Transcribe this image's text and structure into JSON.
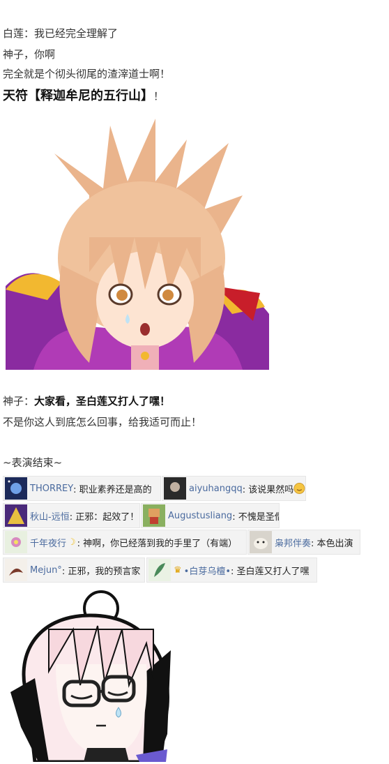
{
  "text": {
    "l1": "白莲：我已经完全理解了",
    "l2": "神子，你啊",
    "l3": "完全就是个彻头彻尾的渣滓道士啊！",
    "l4_bold": "天符【释迦牟尼的五行山】",
    "l4_tail": "！",
    "l5_prefix": "神子：",
    "l5_bold": "大家看，圣白莲又打人了嘿！",
    "l6": "不是你这人到底怎么回事，给我适可而止！",
    "l7": "~表演结束~"
  },
  "comments": [
    {
      "user": "THORREY",
      "msg": ": 职业素养还是高的",
      "avatar": "space-avatar"
    },
    {
      "user": "aiyuhangqq",
      "msg": ": 该说果然吗",
      "avatar": "dark-avatar",
      "emoji": "smile-emoji"
    },
    {
      "user": "秋山-远恒",
      "msg": ": 正邪：起效了！",
      "avatar": "purple-avatar"
    },
    {
      "user": "Augustusliang",
      "msg": ": 不愧是圣僧",
      "avatar": "pixel-avatar"
    },
    {
      "user": "千年夜行",
      "msg": ": 神啊，你已经落到我的手里了（有端）",
      "avatar": "flower-avatar",
      "badge": "moon-icon"
    },
    {
      "user": "枭邦伴奏",
      "msg": ": 本色出演",
      "avatar": "dog-avatar"
    },
    {
      "user": "Mejun°",
      "msg": ": 正邪，我的预言家",
      "avatar": "bird-avatar"
    },
    {
      "user": "•白芽乌檀•",
      "msg": ": 圣白莲又打人了嘿",
      "avatar": "green-avatar",
      "badge": "crown-icon"
    }
  ],
  "colors": {
    "username": "#4a6a9e",
    "text": "#333333"
  }
}
